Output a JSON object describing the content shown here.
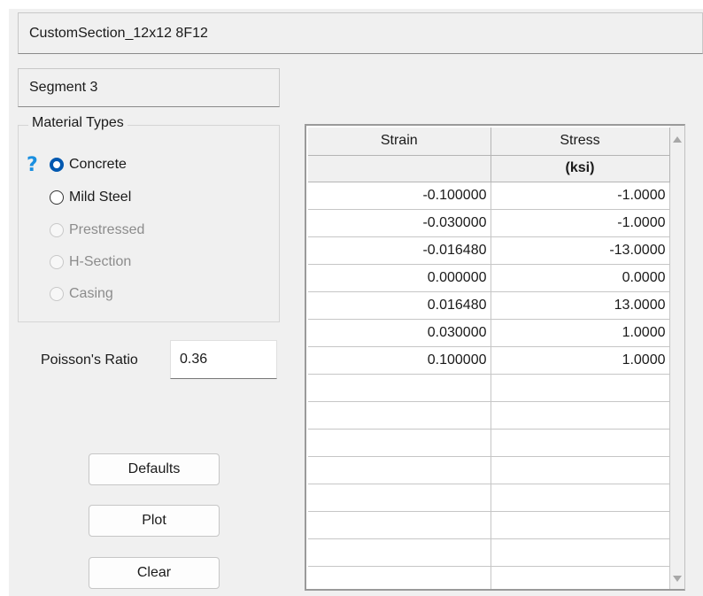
{
  "section_name": "CustomSection_12x12 8F12",
  "segment_name": "Segment 3",
  "material_types": {
    "title": "Material Types",
    "options": [
      {
        "label": "Concrete",
        "checked": true,
        "enabled": true
      },
      {
        "label": "Mild Steel",
        "checked": false,
        "enabled": true
      },
      {
        "label": "Prestressed",
        "checked": false,
        "enabled": false
      },
      {
        "label": "H-Section",
        "checked": false,
        "enabled": false
      },
      {
        "label": "Casing",
        "checked": false,
        "enabled": false
      }
    ],
    "help_glyph": "?"
  },
  "poisson": {
    "label": "Poisson's Ratio",
    "value": "0.36"
  },
  "buttons": {
    "defaults": "Defaults",
    "plot": "Plot",
    "clear": "Clear"
  },
  "table": {
    "columns": [
      "Strain",
      "Stress"
    ],
    "units": [
      "",
      "(ksi)"
    ],
    "rows": [
      [
        "-0.100000",
        "-1.0000"
      ],
      [
        "-0.030000",
        "-1.0000"
      ],
      [
        "-0.016480",
        "-13.0000"
      ],
      [
        "0.000000",
        "0.0000"
      ],
      [
        "0.016480",
        "13.0000"
      ],
      [
        "0.030000",
        "1.0000"
      ],
      [
        "0.100000",
        "1.0000"
      ],
      [
        "",
        ""
      ],
      [
        "",
        ""
      ],
      [
        "",
        ""
      ],
      [
        "",
        ""
      ],
      [
        "",
        ""
      ],
      [
        "",
        ""
      ],
      [
        "",
        ""
      ],
      [
        "",
        ""
      ]
    ]
  },
  "colors": {
    "accent": "#0058b0",
    "help": "#1a8fe0"
  }
}
